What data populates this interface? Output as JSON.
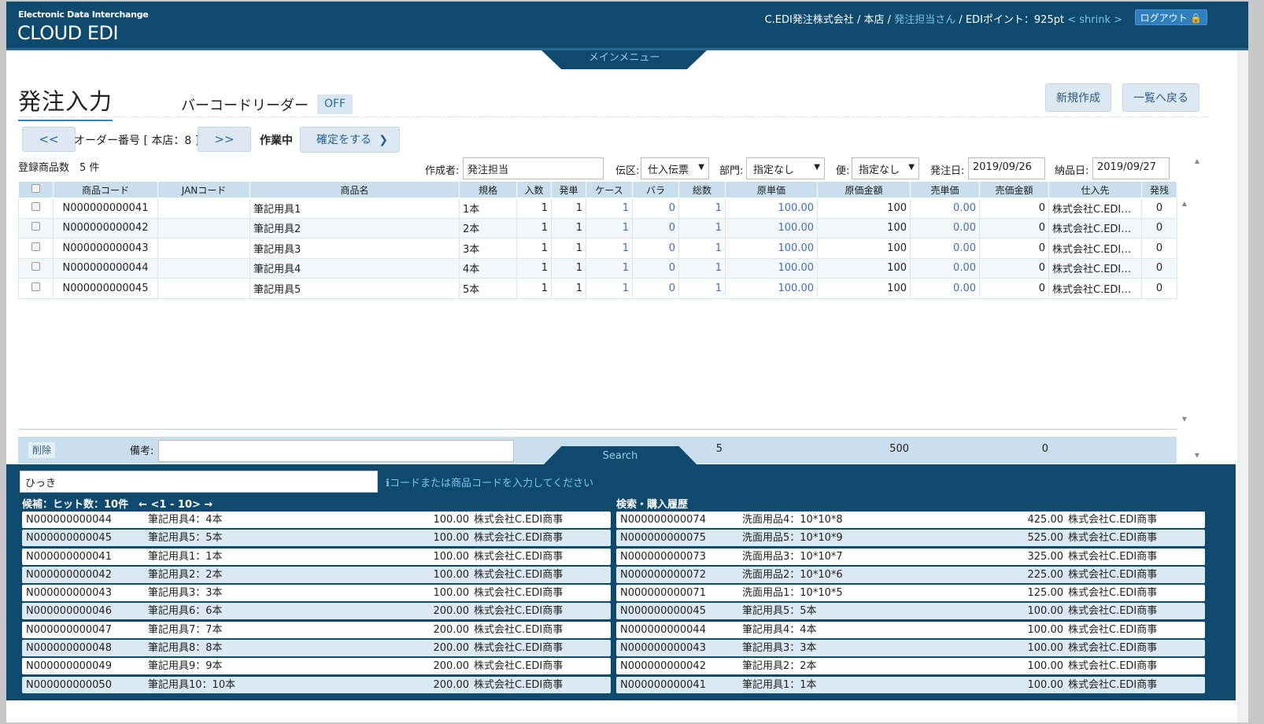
{
  "header": {
    "brand_sub": "Electronic Data Interchange",
    "brand": "CLOUD EDI",
    "company": "C.EDI発注株式会社",
    "sep": " / ",
    "branch": "本店",
    "user": "発注担当さん",
    "points": " / EDIポイント：925pt",
    "shrink": " < shrink > ",
    "logout": "ログアウト 🔒",
    "menu": "メインメニュー"
  },
  "page": {
    "title": "発注入力",
    "barcode_label": "バーコードリーダー",
    "barcode_state": "OFF",
    "new_btn": "新規作成",
    "back_btn": "一覧へ戻る"
  },
  "order": {
    "prev": "<<",
    "next": ">>",
    "label": "オーダー番号 [ 本店：8 ]",
    "status": "作業中",
    "confirm": "確定をする",
    "confirm_arrow": "❯",
    "count": "登録商品数　5 件"
  },
  "filters": {
    "creator_label": "作成者:",
    "creator": "発注担当",
    "slip_label": "伝区:",
    "slip": "仕入伝票",
    "dept_label": "部門:",
    "dept": "指定なし",
    "bin_label": "便:",
    "bin": "指定なし",
    "order_date_label": "発注日:",
    "order_date": "2019/09/26",
    "delivery_label": "納品日:",
    "delivery": "2019/09/27"
  },
  "table": {
    "columns": [
      "",
      "商品コード",
      "JANコード",
      "商品名",
      "規格",
      "入数",
      "発単",
      "ケース",
      "バラ",
      "総数",
      "原単価",
      "原価金額",
      "売単価",
      "売価金額",
      "仕入先",
      "発残"
    ],
    "rows": [
      [
        "N000000000041",
        "",
        "筆記用具1",
        "1本",
        "1",
        "1",
        "1",
        "0",
        "1",
        "100.00",
        "100",
        "0.00",
        "0",
        "株式会社C.EDI商事",
        "0"
      ],
      [
        "N000000000042",
        "",
        "筆記用具2",
        "2本",
        "1",
        "1",
        "1",
        "0",
        "1",
        "100.00",
        "100",
        "0.00",
        "0",
        "株式会社C.EDI商事",
        "0"
      ],
      [
        "N000000000043",
        "",
        "筆記用具3",
        "3本",
        "1",
        "1",
        "1",
        "0",
        "1",
        "100.00",
        "100",
        "0.00",
        "0",
        "株式会社C.EDI商事",
        "0"
      ],
      [
        "N000000000044",
        "",
        "筆記用具4",
        "4本",
        "1",
        "1",
        "1",
        "0",
        "1",
        "100.00",
        "100",
        "0.00",
        "0",
        "株式会社C.EDI商事",
        "0"
      ],
      [
        "N000000000045",
        "",
        "筆記用具5",
        "5本",
        "1",
        "1",
        "1",
        "0",
        "1",
        "100.00",
        "100",
        "0.00",
        "0",
        "株式会社C.EDI商事",
        "0"
      ]
    ]
  },
  "footer": {
    "delete": "削除",
    "note_label": "備考:",
    "total_qty": "5",
    "total_cost": "500",
    "total_sales": "0",
    "search_tab": "Search"
  },
  "search": {
    "keyword": "ひっき",
    "hint": "ℹコードまたは商品コードを入力してください",
    "candidates_label": "候補：ヒット数：10件　← <1 - 10> →",
    "history_label": "検索・購入履歴",
    "candidates": [
      [
        "N000000000044",
        "筆記用具4：4本",
        "100.00",
        "株式会社C.EDI商事"
      ],
      [
        "N000000000045",
        "筆記用具5：5本",
        "100.00",
        "株式会社C.EDI商事"
      ],
      [
        "N000000000041",
        "筆記用具1：1本",
        "100.00",
        "株式会社C.EDI商事"
      ],
      [
        "N000000000042",
        "筆記用具2：2本",
        "100.00",
        "株式会社C.EDI商事"
      ],
      [
        "N000000000043",
        "筆記用具3：3本",
        "100.00",
        "株式会社C.EDI商事"
      ],
      [
        "N000000000046",
        "筆記用具6：6本",
        "200.00",
        "株式会社C.EDI商事"
      ],
      [
        "N000000000047",
        "筆記用具7：7本",
        "200.00",
        "株式会社C.EDI商事"
      ],
      [
        "N000000000048",
        "筆記用具8：8本",
        "200.00",
        "株式会社C.EDI商事"
      ],
      [
        "N000000000049",
        "筆記用具9：9本",
        "200.00",
        "株式会社C.EDI商事"
      ],
      [
        "N000000000050",
        "筆記用具10：10本",
        "200.00",
        "株式会社C.EDI商事"
      ]
    ],
    "history": [
      [
        "N000000000074",
        "洗面用品4：10*10*8",
        "425.00",
        "株式会社C.EDI商事"
      ],
      [
        "N000000000075",
        "洗面用品5：10*10*9",
        "525.00",
        "株式会社C.EDI商事"
      ],
      [
        "N000000000073",
        "洗面用品3：10*10*7",
        "325.00",
        "株式会社C.EDI商事"
      ],
      [
        "N000000000072",
        "洗面用品2：10*10*6",
        "225.00",
        "株式会社C.EDI商事"
      ],
      [
        "N000000000071",
        "洗面用品1：10*10*5",
        "125.00",
        "株式会社C.EDI商事"
      ],
      [
        "N000000000045",
        "筆記用具5：5本",
        "100.00",
        "株式会社C.EDI商事"
      ],
      [
        "N000000000044",
        "筆記用具4：4本",
        "100.00",
        "株式会社C.EDI商事"
      ],
      [
        "N000000000043",
        "筆記用具3：3本",
        "100.00",
        "株式会社C.EDI商事"
      ],
      [
        "N000000000042",
        "筆記用具2：2本",
        "100.00",
        "株式会社C.EDI商事"
      ],
      [
        "N000000000041",
        "筆記用具1：1本",
        "100.00",
        "株式会社C.EDI商事"
      ]
    ]
  }
}
